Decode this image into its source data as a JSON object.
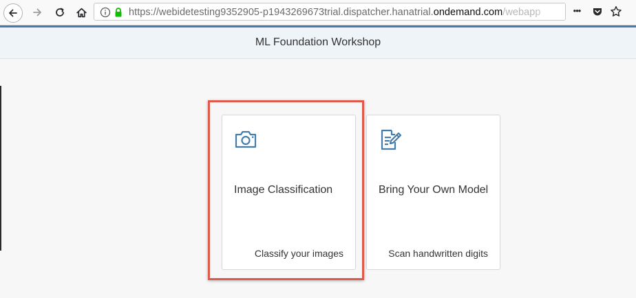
{
  "browser": {
    "url_prefix": "https://webidetesting9352905-p1943269673trial.dispatcher.hanatrial.",
    "url_host": "ondemand.com",
    "url_tail": "/webapp",
    "more_label": "•••"
  },
  "shell": {
    "title": "ML Foundation Workshop"
  },
  "tiles": [
    {
      "title": "Image Classification",
      "footer": "Classify your images",
      "icon": "camera-icon"
    },
    {
      "title": "Bring Your Own Model",
      "footer": "Scan handwritten digits",
      "icon": "document-edit-icon"
    }
  ],
  "colors": {
    "accent": "#427cac",
    "icon": "#427cac",
    "highlight": "#e05a4b",
    "secure_lock": "#12bc00"
  }
}
